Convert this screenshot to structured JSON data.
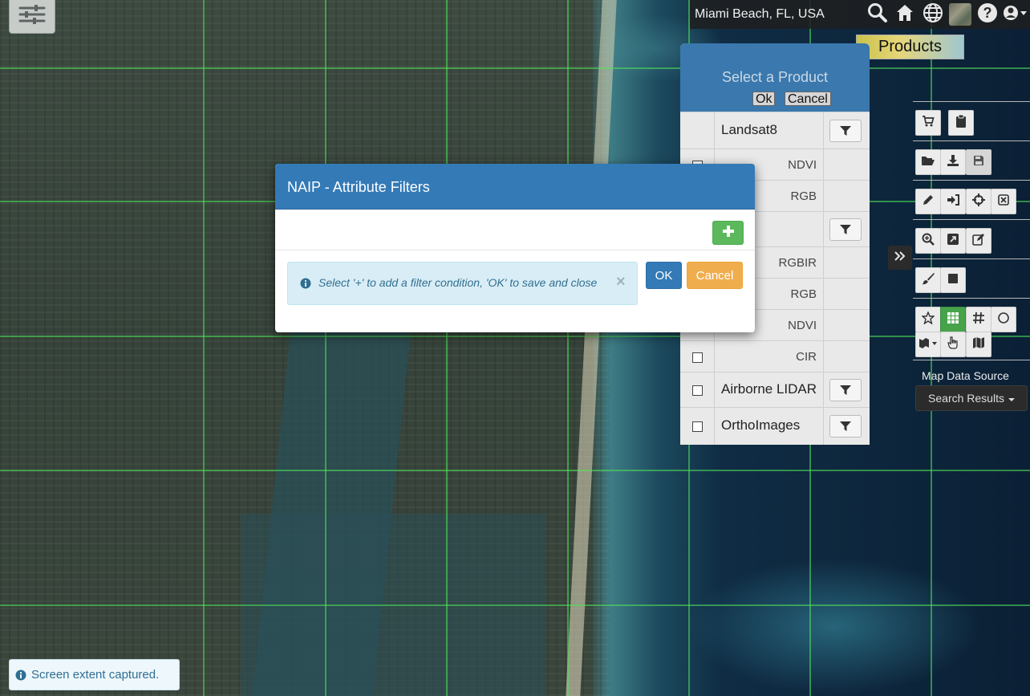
{
  "search": {
    "value": "Miami Beach, FL, USA",
    "placeholder": ""
  },
  "toolbar_icons": [
    "search-icon",
    "home-icon",
    "globe-icon",
    "basemap-thumbnail",
    "help-icon",
    "user-icon"
  ],
  "products_label": "Products",
  "product_panel": {
    "title": "Select a Product",
    "ok_label": "Ok",
    "cancel_label": "Cancel",
    "rows": [
      {
        "name": "Landsat8",
        "sub": "",
        "has_filter": true,
        "has_checkbox": false
      },
      {
        "name": "",
        "sub": "NDVI",
        "has_filter": false,
        "has_checkbox": true
      },
      {
        "name": "",
        "sub": "RGB",
        "has_filter": false,
        "has_checkbox": false
      },
      {
        "name": "",
        "sub": "",
        "has_filter": true,
        "has_checkbox": false
      },
      {
        "name": "",
        "sub": "RGBIR",
        "has_filter": false,
        "has_checkbox": false
      },
      {
        "name": "",
        "sub": "RGB",
        "has_filter": false,
        "has_checkbox": false
      },
      {
        "name": "",
        "sub": "NDVI",
        "has_filter": false,
        "has_checkbox": false
      },
      {
        "name": "",
        "sub": "CIR",
        "has_filter": false,
        "has_checkbox": true
      },
      {
        "name": "Airborne LIDAR",
        "sub": "",
        "has_filter": true,
        "has_checkbox": true
      },
      {
        "name": "OrthoImages",
        "sub": "",
        "has_filter": true,
        "has_checkbox": true
      }
    ]
  },
  "right_toolbar": {
    "map_data_source_label": "Map Data Source",
    "map_data_source_value": "Search Results"
  },
  "modal": {
    "title": "NAIP - Attribute Filters",
    "add_label": "+",
    "info_text": "Select '+' to add a filter condition, 'OK' to save and close",
    "close_label": "×",
    "ok_label": "OK",
    "cancel_label": "Cancel"
  },
  "toast": {
    "text": "Screen extent captured."
  },
  "colors": {
    "primary": "#337ab7",
    "success": "#5cb85c",
    "warning": "#f0ad4e",
    "info_bg": "#d9edf7",
    "info_text": "#31708f",
    "grid_line": "#50e65a"
  }
}
